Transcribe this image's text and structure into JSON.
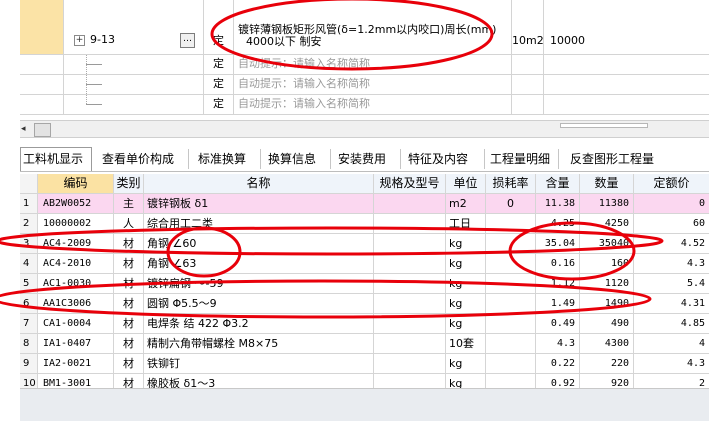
{
  "quota_grid": {
    "rows": [
      {
        "code": "9-13",
        "more": "…",
        "type": "定",
        "name_line1": "镀锌薄钢板矩形风管(δ=1.2mm以内咬口)周长(mm)",
        "name_line2": "4000以下 制安",
        "unit": "10m2",
        "quantity": "10000"
      },
      {
        "type": "定",
        "hint": "自动提示：请输入名称简称"
      },
      {
        "type": "定",
        "hint": "自动提示：请输入名称简称"
      },
      {
        "type": "定",
        "hint": "自动提示：请输入名称简称"
      }
    ],
    "expand_glyph": "+"
  },
  "scrollbar": {
    "left_arrow": "◂"
  },
  "tabs": [
    {
      "label": "工料机显示",
      "active": true
    },
    {
      "label": "查看单价构成"
    },
    {
      "label": "标准换算"
    },
    {
      "label": "换算信息"
    },
    {
      "label": "安装费用"
    },
    {
      "label": "特征及内容"
    },
    {
      "label": "工程量明细"
    },
    {
      "label": "反查图形工程量"
    }
  ],
  "materials": {
    "headers": {
      "no": "",
      "code": "编码",
      "category": "类别",
      "name": "名称",
      "spec": "规格及型号",
      "unit": "单位",
      "loss_rate": "损耗率",
      "quantity": "含量",
      "amount": "数量",
      "fixed_price": "定额价"
    },
    "rows": [
      {
        "no": "1",
        "code": "AB2W0052",
        "category": "主",
        "name": "镀锌钢板 δ1",
        "spec": "",
        "unit": "m2",
        "loss_rate": "0",
        "quantity": "11.38",
        "amount": "11380",
        "fixed_price": "0"
      },
      {
        "no": "2",
        "code": "10000002",
        "category": "人",
        "name": "综合用工二类",
        "spec": "",
        "unit": "工日",
        "loss_rate": "",
        "quantity": "4.25",
        "amount": "4250",
        "fixed_price": "60"
      },
      {
        "no": "3",
        "code": "AC4-2009",
        "category": "材",
        "name": "角钢 ∠60",
        "spec": "",
        "unit": "kg",
        "loss_rate": "",
        "quantity": "35.04",
        "amount": "35040",
        "fixed_price": "4.52"
      },
      {
        "no": "4",
        "code": "AC4-2010",
        "category": "材",
        "name": "角钢 ∠63",
        "spec": "",
        "unit": "kg",
        "loss_rate": "",
        "quantity": "0.16",
        "amount": "160",
        "fixed_price": "4.3"
      },
      {
        "no": "5",
        "code": "AC1-0030",
        "category": "材",
        "name": "镀锌扁钢 ～-59",
        "spec": "",
        "unit": "kg",
        "loss_rate": "",
        "quantity": "1.12",
        "amount": "1120",
        "fixed_price": "5.4"
      },
      {
        "no": "6",
        "code": "AA1C3006",
        "category": "材",
        "name": "圆钢 Φ5.5～9",
        "spec": "",
        "unit": "kg",
        "loss_rate": "",
        "quantity": "1.49",
        "amount": "1490",
        "fixed_price": "4.31"
      },
      {
        "no": "7",
        "code": "CA1-0004",
        "category": "材",
        "name": "电焊条 结 422 Φ3.2",
        "spec": "",
        "unit": "kg",
        "loss_rate": "",
        "quantity": "0.49",
        "amount": "490",
        "fixed_price": "4.85"
      },
      {
        "no": "8",
        "code": "IA1-0407",
        "category": "材",
        "name": "精制六角带帽螺栓 M8×75",
        "spec": "",
        "unit": "10套",
        "loss_rate": "",
        "quantity": "4.3",
        "amount": "4300",
        "fixed_price": "4"
      },
      {
        "no": "9",
        "code": "IA2-0021",
        "category": "材",
        "name": "铁铆钉",
        "spec": "",
        "unit": "kg",
        "loss_rate": "",
        "quantity": "0.22",
        "amount": "220",
        "fixed_price": "4.3"
      },
      {
        "no": "10",
        "code": "BM1-3001",
        "category": "材",
        "name": "橡胶板 δ1～3",
        "spec": "",
        "unit": "kg",
        "loss_rate": "",
        "quantity": "0.92",
        "amount": "920",
        "fixed_price": "2"
      }
    ]
  },
  "colors": {
    "annotation": "#e8000a",
    "selection": "#fbe3a6",
    "main_material_row": "#fbd7f0",
    "header": "#eff4fa"
  }
}
